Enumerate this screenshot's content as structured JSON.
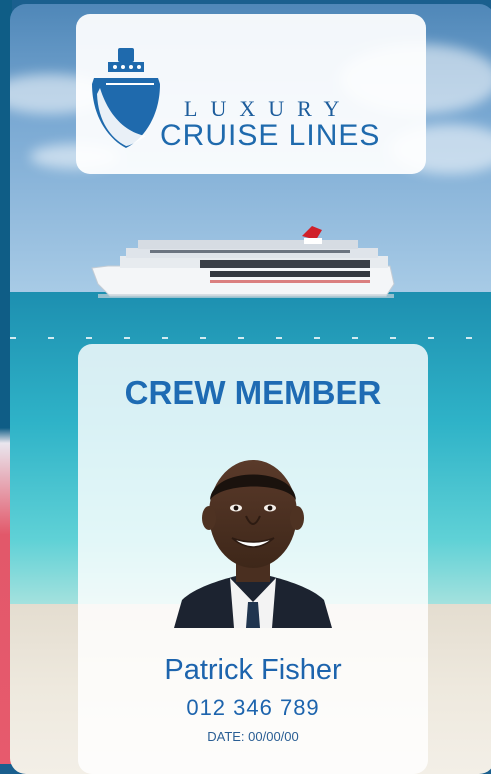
{
  "brand": {
    "line1": "LUXURY",
    "line2": "CRUISE LINES",
    "logo_icon": "cruise-ship-icon",
    "color_primary": "#1e6bb3"
  },
  "badge": {
    "role": "CREW MEMBER",
    "name": "Patrick Fisher",
    "id_number": "012 346 789",
    "date": "DATE: 00/00/00",
    "photo": "employee-portrait"
  }
}
